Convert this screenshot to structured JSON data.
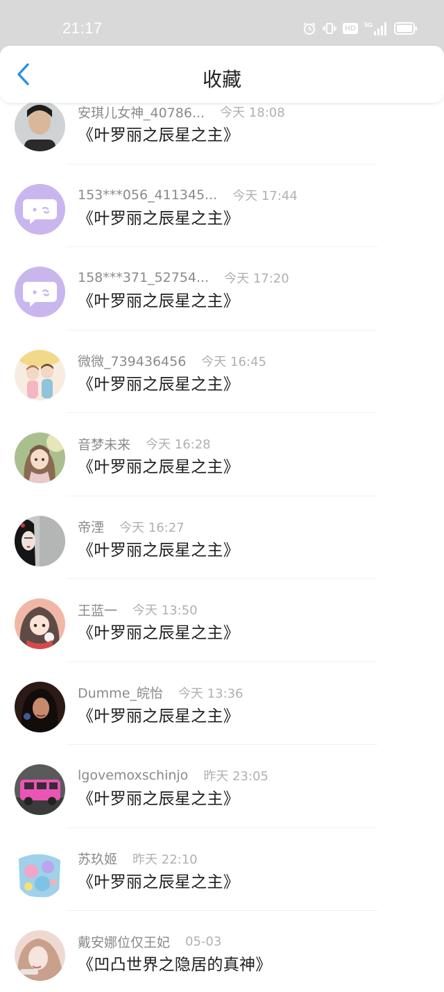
{
  "status_bar": {
    "time": "21:17",
    "network": "5G",
    "hd_label": "HD"
  },
  "nav": {
    "title": "收藏",
    "back_icon": "chevron-left-icon",
    "accent_color": "#2a8de9"
  },
  "items": [
    {
      "username": "安琪儿女神_40786...",
      "time": "今天 18:08",
      "title": "《叶罗丽之辰星之主》",
      "avatar": "photo-portrait"
    },
    {
      "username": "153***056_411345...",
      "time": "今天 17:44",
      "title": "《叶罗丽之辰星之主》",
      "avatar": "default-chat-bubble"
    },
    {
      "username": "158***371_52754...",
      "time": "今天 17:20",
      "title": "《叶罗丽之辰星之主》",
      "avatar": "default-chat-bubble"
    },
    {
      "username": "微微_739436456",
      "time": "今天 16:45",
      "title": "《叶罗丽之辰星之主》",
      "avatar": "anime-couple"
    },
    {
      "username": "音梦未来",
      "time": "今天 16:28",
      "title": "《叶罗丽之辰星之主》",
      "avatar": "anime-girl"
    },
    {
      "username": "帝湮",
      "time": "今天 16:27",
      "title": "《叶罗丽之辰星之主》",
      "avatar": "ink-painting"
    },
    {
      "username": "王蓝一",
      "time": "今天 13:50",
      "title": "《叶罗丽之辰星之主》",
      "avatar": "anime-girl-cat"
    },
    {
      "username": "Dumme_皖怡",
      "time": "今天 13:36",
      "title": "《叶罗丽之辰星之主》",
      "avatar": "dark-portrait"
    },
    {
      "username": "lgovemoxschinjo",
      "time": "昨天 23:05",
      "title": "《叶罗丽之辰星之主》",
      "avatar": "pink-car"
    },
    {
      "username": "苏玖姬",
      "time": "昨天 22:10",
      "title": "《叶罗丽之辰星之主》",
      "avatar": "colorful-art"
    },
    {
      "username": "戴安娜位仅王妃",
      "time": "05-03",
      "title": "《凹凸世界之隐居的真神》",
      "avatar": "blurred-portrait"
    }
  ]
}
